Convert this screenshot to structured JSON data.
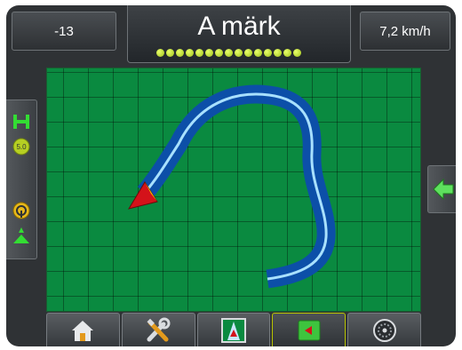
{
  "header": {
    "left_value": "-13",
    "title": "A märk",
    "speed": "7,2 km/h",
    "lightbar_dot_count": 15
  },
  "left_panel": {
    "icons": [
      "boom-icon",
      "section-badge-icon",
      "steering-icon",
      "coverage-icon"
    ],
    "badge_label": "5.0"
  },
  "right_panel": {
    "icons": [
      "back-arrow-icon"
    ]
  },
  "bottom_tabs": [
    {
      "name": "home",
      "icon": "home-icon",
      "active": false
    },
    {
      "name": "tools",
      "icon": "tools-icon",
      "active": false
    },
    {
      "name": "vehicle-view",
      "icon": "vehicle-view-icon",
      "active": false
    },
    {
      "name": "field-view",
      "icon": "field-view-icon",
      "active": true
    },
    {
      "name": "real-time",
      "icon": "gauge-icon",
      "active": false
    }
  ],
  "colors": {
    "field": "#0a8a40",
    "path_outer": "#0c4fa8",
    "path_inner": "#a8e0ff",
    "vehicle": "#d4121a",
    "vehicle_tip": "#f0d000",
    "accent": "#b8c400"
  }
}
